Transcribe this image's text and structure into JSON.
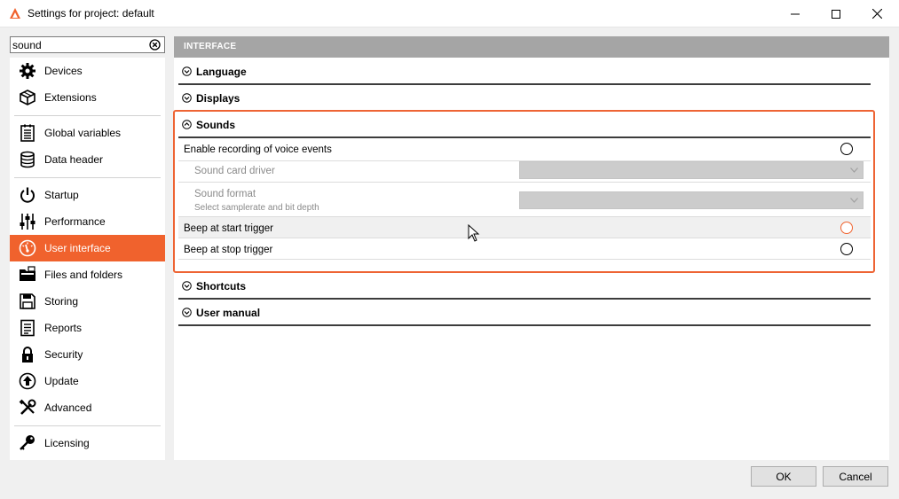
{
  "window": {
    "title": "Settings for project: default",
    "accent_color": "#f0622d"
  },
  "search": {
    "value": "sound",
    "clear_icon": "clear-circle-icon"
  },
  "sidebar": {
    "items": [
      {
        "label": "Devices",
        "icon": "gear-icon"
      },
      {
        "label": "Extensions",
        "icon": "cube-icon"
      },
      {
        "label": "Global variables",
        "icon": "list-document-icon"
      },
      {
        "label": "Data header",
        "icon": "database-icon"
      },
      {
        "label": "Startup",
        "icon": "power-icon"
      },
      {
        "label": "Performance",
        "icon": "sliders-icon"
      },
      {
        "label": "User interface",
        "icon": "gauge-icon",
        "active": true
      },
      {
        "label": "Files and folders",
        "icon": "folder-icon"
      },
      {
        "label": "Storing",
        "icon": "floppy-disk-icon"
      },
      {
        "label": "Reports",
        "icon": "report-icon"
      },
      {
        "label": "Security",
        "icon": "padlock-icon"
      },
      {
        "label": "Update",
        "icon": "update-arrow-icon"
      },
      {
        "label": "Advanced",
        "icon": "tools-icon"
      },
      {
        "label": "Licensing",
        "icon": "key-icon"
      }
    ]
  },
  "panel": {
    "header": "INTERFACE",
    "sections": {
      "language": "Language",
      "displays": "Displays",
      "sounds": "Sounds",
      "shortcuts": "Shortcuts",
      "user_manual": "User manual"
    },
    "sounds": {
      "enable_recording": "Enable recording of voice events",
      "sound_card_driver": "Sound card driver",
      "sound_format": "Sound format",
      "sound_format_hint": "Select samplerate and bit depth",
      "beep_start": "Beep at start trigger",
      "beep_stop": "Beep at stop trigger"
    }
  },
  "buttons": {
    "ok": "OK",
    "cancel": "Cancel"
  }
}
